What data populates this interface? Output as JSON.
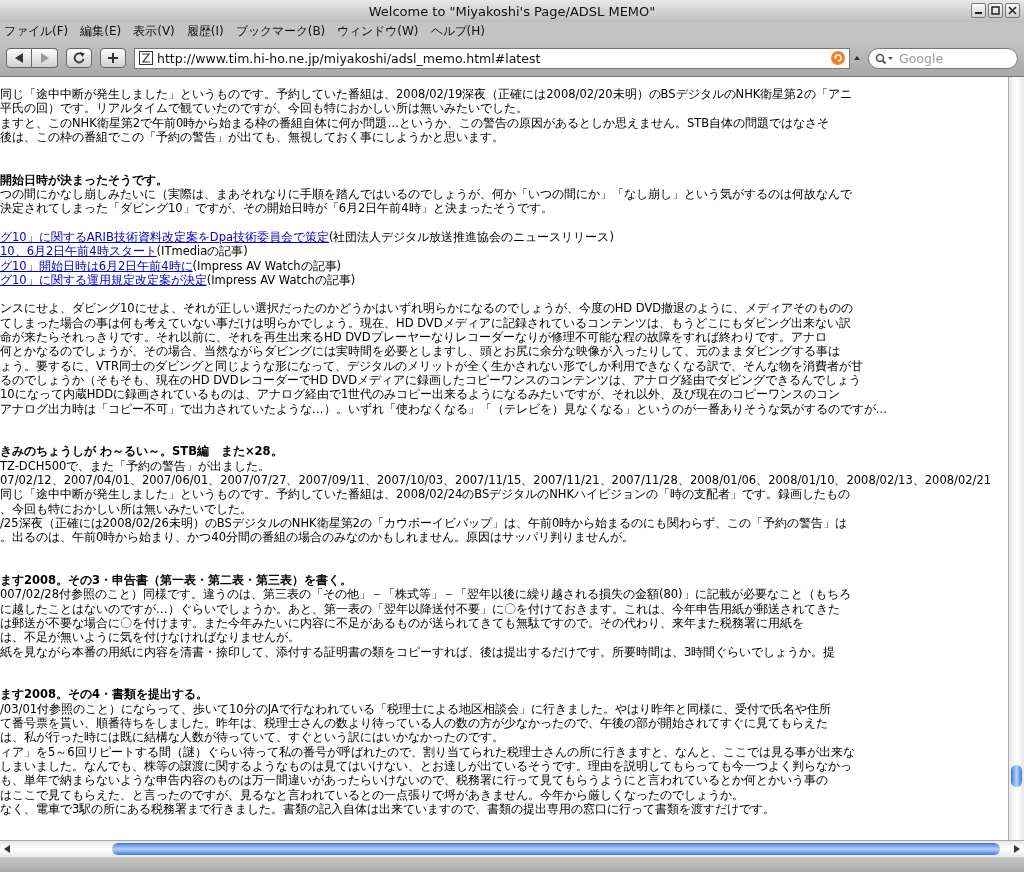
{
  "window": {
    "title": "Welcome to \"Miyakoshi's Page/ADSL MEMO\""
  },
  "menu": [
    "ファイル(F)",
    "編集(E)",
    "表示(V)",
    "履歴(I)",
    "ブックマーク(B)",
    "ウィンドウ(W)",
    "ヘルプ(H)"
  ],
  "toolbar": {
    "url": "http://www.tim.hi-ho.ne.jp/miyakoshi/adsl_memo.html#latest",
    "search": {
      "placeholder": "Google"
    }
  },
  "content": [
    {
      "kind": "paragraph",
      "lines": [
        "同じ「途中中断が発生しました」というものです。予約していた番組は、2008/02/19深夜（正確には2008/02/20未明）のBSデジタルのNHK衛星第2の「アニ",
        "平氏の回）です。リアルタイムで観ていたのですが、今回も特におかしい所は無いみたいでした。",
        "ますと、このNHK衛星第2で午前0時から始まる枠の番組自体に何か問題…というか、この警告の原因があるとしか思えません。STB自体の問題ではなさそ",
        "後は、この枠の番組でこの「予約の警告」が出ても、無視しておく事にしようかと思います。"
      ]
    },
    {
      "kind": "heading",
      "lines": [
        "開始日時が決まったそうです。"
      ]
    },
    {
      "kind": "paragraph",
      "lines": [
        "つの間にかなし崩しみたいに（実際は、まあそれなりに手順を踏んではいるのでしょうが、何か「いつの間にか」「なし崩し」という気がするのは何故なんで",
        "決定されてしまった「ダビング10」ですが、その開始日時が「6月2日午前4時」と決まったそうです。"
      ]
    },
    {
      "kind": "links",
      "items": [
        {
          "link": "グ10」に関するARIB技術資料改定案をDpa技術委員会で策定",
          "note": "(社団法人デジタル放送推進協会のニュースリリース)"
        },
        {
          "link": "10、6月2日午前4時スタート",
          "note": "(ITmediaの記事)"
        },
        {
          "link": "グ10」開始日時は6月2日午前4時に",
          "note": "(Impress AV Watchの記事)"
        },
        {
          "link": "グ10」に関する運用規定改定案が決定",
          "note": "(Impress AV Watchの記事)"
        }
      ]
    },
    {
      "kind": "paragraph",
      "lines": [
        "ンスにせよ、ダビング10にせよ、それが正しい選択だったのかどうかはいずれ明らかになるのでしょうが、今度のHD DVD撤退のように、メディアそのものの",
        "てしまった場合の事は何も考えていない事だけは明らかでしょう。現在、HD DVDメディアに記録されているコンテンツは、もうどこにもダビング出来ない訳",
        "命が来たらそれっきりです。それ以前に、それを再生出来るHD DVDプレーヤーなりレコーダーなりが修理不可能な程の故障をすれば終わりです。アナロ",
        "何とかなるのでしょうが、その場合、当然ながらダビングには実時間を必要としますし、頭とお尻に余分な映像が入ったりして、元のままダビングする事は",
        "ょう。要するに、VTR同士のダビングと同じような形になって、デジタルのメリットが全く生かされない形でしか利用できなくなる訳で、そんな物を消費者が甘",
        "るのでしょうか（そもそも、現在のHD DVDレコーダーでHD DVDメディアに録画したコピーワンスのコンテンツは、アナログ経由でダビングできるんでしょう",
        "10になって内蔵HDDに録画されているものは、アナログ経由で1世代のみコピー出来るようになるみたいですが、それ以外、及び現在のコピーワンスのコン",
        "アナログ出力時は「コピー不可」で出力されていたような…）。いずれ「使わなくなる」「（テレビを）見なくなる」というのが一番ありそうな気がするのですが…"
      ]
    },
    {
      "kind": "heading",
      "lines": [
        "きみのちょうしが わ～るい～。STB編　また×28。"
      ]
    },
    {
      "kind": "paragraph",
      "lines": [
        "TZ-DCH500で、また「予約の警告」が出ました。",
        "07/02/12、2007/04/01、2007/06/01、2007/07/27、2007/09/11、2007/10/03、2007/11/15、2007/11/21、2007/11/28、2008/01/06、2008/01/10、2008/02/13、2008/02/21",
        "同じ「途中中断が発生しました」というものです。予約していた番組は、2008/02/24のBSデジタルのNHKハイビジョンの「時の支配者」です。録画したもの",
        "、今回も特におかしい所は無いみたいでした。",
        "/25深夜（正確には2008/02/26未明）のBSデジタルのNHK衛星第2の「カウボーイビバップ」は、午前0時から始まるのにも関わらず、この「予約の警告」は",
        "。出るのは、午前0時から始まり、かつ40分間の番組の場合のみなのかもしれません。原因はサッパリ判りませんが。"
      ]
    },
    {
      "kind": "heading",
      "lines": [
        "ます2008。その3・申告書（第一表・第二表・第三表）を書く。"
      ]
    },
    {
      "kind": "paragraph",
      "lines": [
        "007/02/28付参照のこと）同様です。違うのは、第三表の「その他」－「株式等」－「翌年以後に繰り越される損失の金額(80)」に記載が必要なこと（もちろ",
        "に越したことはないのですが…）ぐらいでしょうか。あと、第一表の「翌年以降送付不要」に〇を付けておきます。これは、今年申告用紙が郵送されてきた",
        "は郵送が不要な場合に〇を付けます。また今年みたいに内容に不足があるものが送られてきても無駄ですので。その代わり、来年また税務署に用紙を",
        "は、不足が無いように気を付けなければなりませんが。",
        "紙を見ながら本番の用紙に内容を清書・捺印して、添付する証明書の類をコピーすれば、後は提出するだけです。所要時間は、3時間ぐらいでしょうか。提"
      ]
    },
    {
      "kind": "heading",
      "lines": [
        "ます2008。その4・書類を提出する。"
      ]
    },
    {
      "kind": "paragraph",
      "lines": [
        "/03/01付参照のこと）にならって、歩いて10分のJAで行なわれている「税理士による地区相談会」に行きました。やはり昨年と同様に、受付で氏名や住所",
        "て番号票を貰い、順番待ちをしました。昨年は、税理士さんの数より待っている人の数の方が少なかったので、午後の部が開始されてすぐに見てもらえた",
        "は、私が行った時には既に結構な人数が待っていて、すぐという訳にはいかなかったのです。",
        "ィア」を5～6回リピートする間（謎）ぐらい待って私の番号が呼ばれたので、割り当てられた税理士さんの所に行きますと、なんと、ここでは見る事が出来な",
        "しまいました。なんでも、株等の譲渡に関するようなものは見てはいけない、とお達しが出ているそうです。理由を説明してもらっても今一つよく判らなかっ",
        "も、単年で納まらないような申告内容のものは万一間違いがあったらいけないので、税務署に行って見てもらうようにと言われているとか何とかいう事の",
        "はここで見てもらえた、と言ったのですが、見るなと言われているとの一点張りで埒があきません。今年から厳しくなったのでしょうか。",
        "なく、電車で3駅の所にある税務署まで行きました。書類の記入自体は出来ていますので、書類の提出専用の窓口に行って書類を渡すだけです。"
      ]
    }
  ]
}
